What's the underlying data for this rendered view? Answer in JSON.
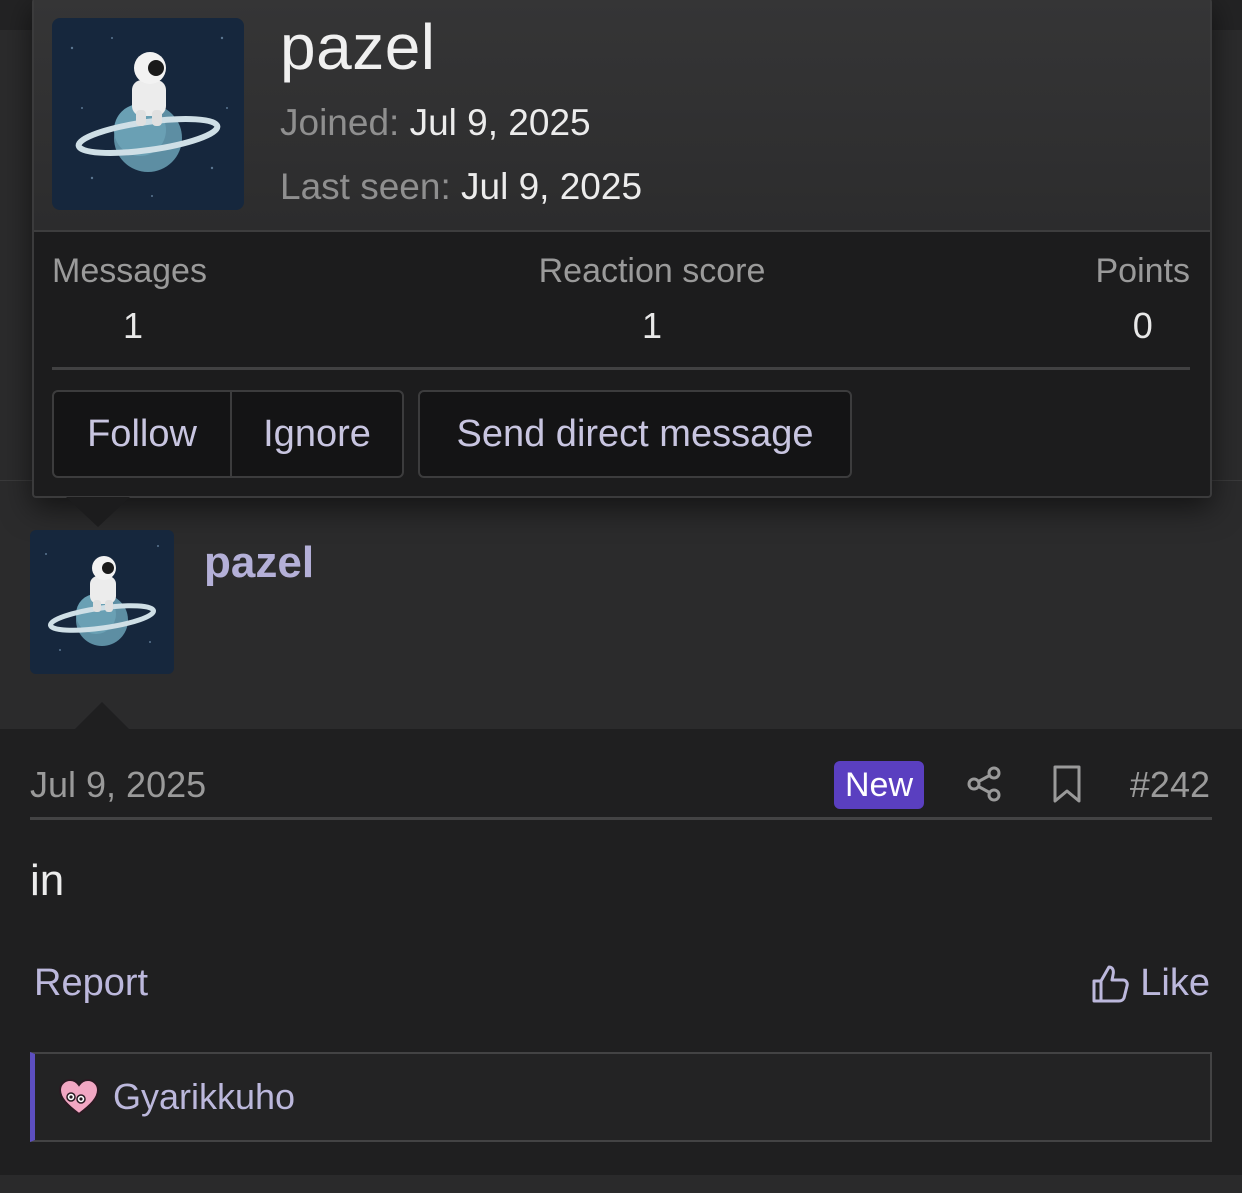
{
  "popup": {
    "username": "pazel",
    "joined_label": "Joined:",
    "joined_value": "Jul 9, 2025",
    "last_seen_label": "Last seen:",
    "last_seen_value": "Jul 9, 2025",
    "stats": [
      {
        "label": "Messages",
        "value": "1"
      },
      {
        "label": "Reaction score",
        "value": "1"
      },
      {
        "label": "Points",
        "value": "0"
      }
    ],
    "buttons": {
      "follow": "Follow",
      "ignore": "Ignore",
      "direct_message": "Send direct message"
    }
  },
  "post": {
    "username": "pazel",
    "date": "Jul 9, 2025",
    "badge": "New",
    "number": "#242",
    "body": "in",
    "report": "Report",
    "like": "Like",
    "reaction_user": "Gyarikkuho"
  },
  "icons": {
    "share": "share-icon",
    "bookmark": "bookmark-icon",
    "like": "thumbs-up-icon",
    "reaction": "heart-icon",
    "avatar": "astronaut-on-planet-avatar"
  },
  "colors": {
    "accent_purple": "#5a3fc0",
    "link_lavender": "#bcb8dc",
    "username_lavender": "#b4b0d8",
    "background_dark": "#1f1f20"
  }
}
